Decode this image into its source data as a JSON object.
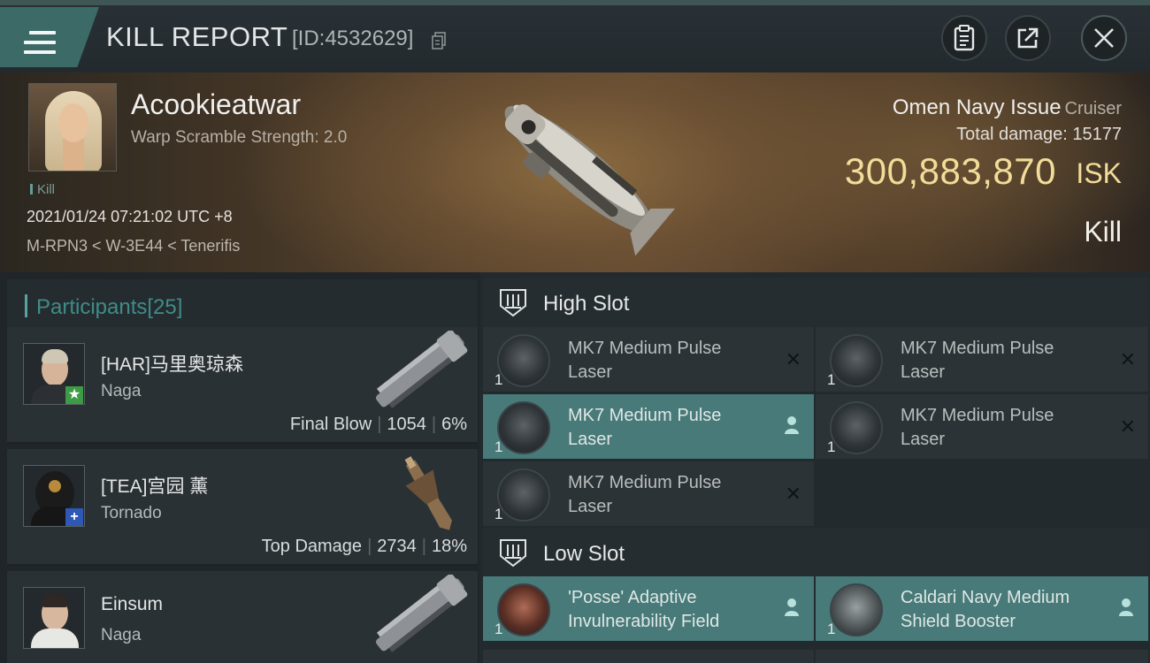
{
  "header": {
    "title": "KILL REPORT",
    "report_id": "[ID:4532629]"
  },
  "victim": {
    "name": "Acookieatwar",
    "warp_scramble": "Warp Scramble Strength: 2.0",
    "tag": "Kill",
    "datetime": "2021/01/24 07:21:02 UTC +8",
    "location": "M-RPN3 < W-3E44 < Tenerifis",
    "ship_name": "Omen Navy Issue",
    "ship_class": "Cruiser",
    "total_damage_label": "Total damage:",
    "total_damage": "15177",
    "isk_value": "300,883,870",
    "isk_unit": "ISK",
    "result": "Kill"
  },
  "participants": {
    "label": "Participants",
    "count": "[25]",
    "list": [
      {
        "name": "[HAR]马里奥琼森",
        "ship": "Naga",
        "role": "Final Blow",
        "damage": "1054",
        "percent": "6%",
        "badge": "star"
      },
      {
        "name": "[TEA]宫园 薰",
        "ship": "Tornado",
        "role": "Top Damage",
        "damage": "2734",
        "percent": "18%",
        "badge": "plus"
      },
      {
        "name": "Einsum",
        "ship": "Naga",
        "role": "",
        "damage": "",
        "percent": "",
        "badge": ""
      }
    ]
  },
  "fitting": {
    "high_slot_label": "High Slot",
    "low_slot_label": "Low Slot",
    "high": [
      {
        "qty": "1",
        "name_line1": "MK7 Medium Pulse",
        "name_line2": "Laser",
        "status": "destroyed"
      },
      {
        "qty": "1",
        "name_line1": "MK7 Medium Pulse",
        "name_line2": "Laser",
        "status": "destroyed"
      },
      {
        "qty": "1",
        "name_line1": "MK7 Medium Pulse",
        "name_line2": "Laser",
        "status": "dropped"
      },
      {
        "qty": "1",
        "name_line1": "MK7 Medium Pulse",
        "name_line2": "Laser",
        "status": "destroyed"
      },
      {
        "qty": "1",
        "name_line1": "MK7 Medium Pulse",
        "name_line2": "Laser",
        "status": "destroyed"
      }
    ],
    "low": [
      {
        "qty": "1",
        "name_line1": "'Posse' Adaptive",
        "name_line2": "Invulnerability Field",
        "status": "dropped"
      },
      {
        "qty": "1",
        "name_line1": "Caldari Navy Medium",
        "name_line2": "Shield Booster",
        "status": "dropped"
      }
    ]
  },
  "icons": {
    "menu": "hamburger-icon",
    "copy": "copy-icon",
    "clipboard": "clipboard-icon",
    "share": "share-icon",
    "close": "close-icon",
    "destroyed": "x-icon",
    "dropped": "person-icon",
    "slot": "slot-rack-icon"
  },
  "colors": {
    "accent_teal": "#477a78",
    "isk_gold": "#f2dc9a",
    "participants_label": "#3f8c88",
    "final_blow_badge": "#3d9b45",
    "top_damage_badge": "#2d58b5"
  }
}
